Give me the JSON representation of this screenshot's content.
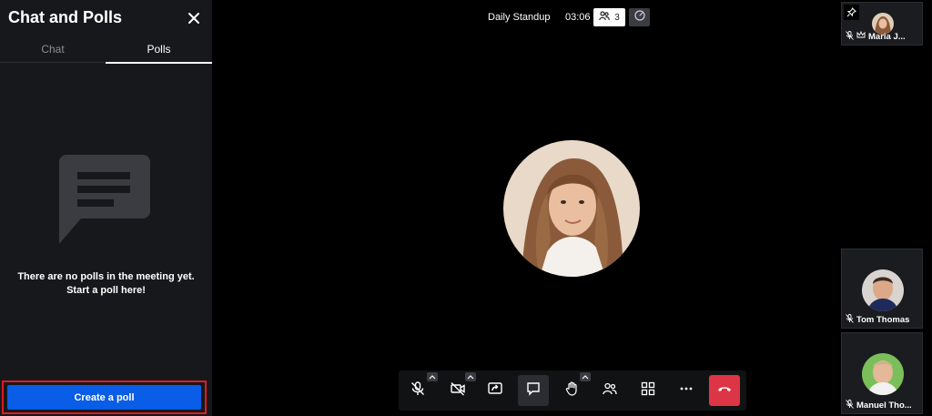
{
  "sidebar": {
    "title": "Chat and Polls",
    "tabs": [
      {
        "label": "Chat",
        "active": false
      },
      {
        "label": "Polls",
        "active": true
      }
    ],
    "empty_state": {
      "line1": "There are no polls in the meeting yet.",
      "line2": "Start a poll here!"
    },
    "create_poll_label": "Create a poll"
  },
  "header": {
    "meeting_name": "Daily Standup",
    "timer": "03:06",
    "participant_count": "3"
  },
  "participants": [
    {
      "name": "Maria J...",
      "muted": true,
      "moderator": true,
      "pinned_control": true
    },
    {
      "name": "Tom Thomas",
      "muted": true,
      "moderator": false
    },
    {
      "name": "Manuel Tho...",
      "muted": true,
      "moderator": false
    }
  ],
  "toolbar": {
    "buttons": [
      "microphone-muted-icon",
      "camera-off-icon",
      "share-screen-icon",
      "chat-icon",
      "raise-hand-icon",
      "participants-icon",
      "tile-view-icon",
      "more-icon",
      "hangup-icon"
    ]
  },
  "colors": {
    "accent": "#0a5de6",
    "highlight": "#e01b24",
    "hangup": "#dc3545",
    "sidebar_bg": "#17181c"
  }
}
